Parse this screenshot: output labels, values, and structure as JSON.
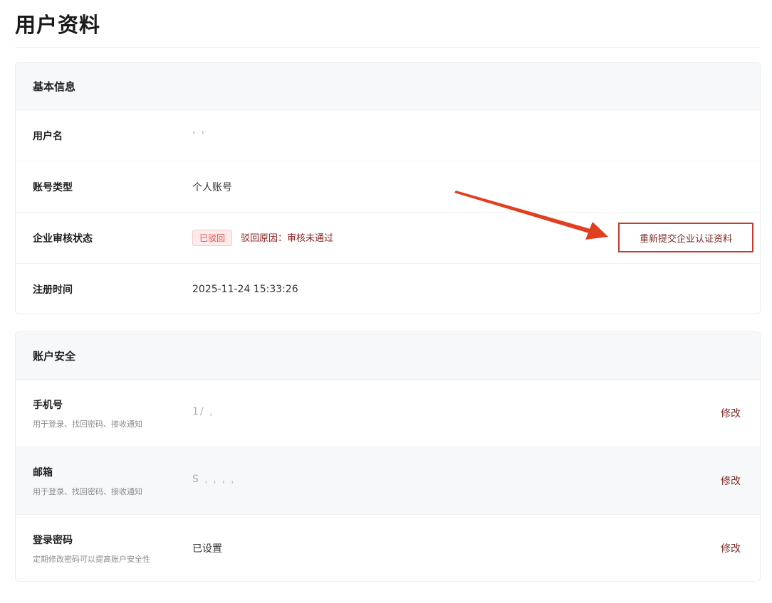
{
  "page": {
    "title": "用户资料"
  },
  "basic_info": {
    "header": "基本信息",
    "username": {
      "label": "用户名",
      "value": "‘ '"
    },
    "account_type": {
      "label": "账号类型",
      "value": "个人账号"
    },
    "enterprise_status": {
      "label": "企业审核状态",
      "badge": "已驳回",
      "reason": "驳回原因：审核未通过",
      "resubmit_label": "重新提交企业认证资料"
    },
    "register_time": {
      "label": "注册时间",
      "value": "2025-11-24 15:33:26"
    }
  },
  "account_security": {
    "header": "账户安全",
    "phone": {
      "label": "手机号",
      "hint": "用于登录、找回密码、接收通知",
      "value": "1/ ˌ",
      "action": "修改"
    },
    "email": {
      "label": "邮箱",
      "hint": "用于登录、找回密码、接收通知",
      "value": "S ˌ ˌ ˌ ˌ",
      "action": "修改"
    },
    "password": {
      "label": "登录密码",
      "hint": "定期修改密码可以提高账户安全性",
      "value": "已设置",
      "action": "修改"
    }
  },
  "colors": {
    "accent": "#c9382a",
    "link": "#7a2a22",
    "badge_bg": "#fdeceb",
    "arrow": "#e0401f"
  }
}
